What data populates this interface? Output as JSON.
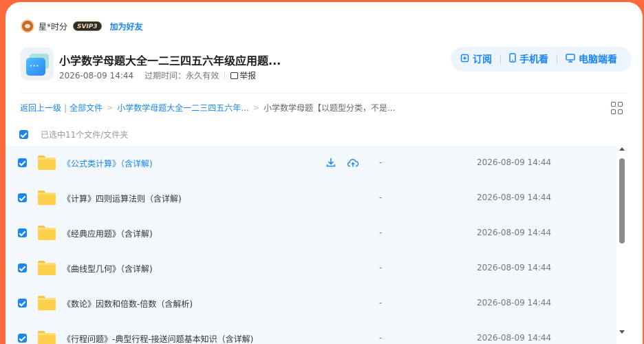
{
  "share": {
    "user_name": "星*时分",
    "vip_badge": "SVIP3",
    "add_friend": "加为好友"
  },
  "file": {
    "title": "小学数学母题大全一二三四五六年级应用题...",
    "date": "2026-08-09 14:44",
    "expire": "过期时间：永久有效",
    "report": "举报"
  },
  "actions": {
    "subscribe": "订阅",
    "mobile": "手机看",
    "desktop": "电脑端看"
  },
  "breadcrumb": {
    "back": "返回上一级",
    "all_files": "全部文件",
    "parent": "小学数学母题大全一二三四五六年...",
    "current": "小学数学母题【以题型分类，不是..."
  },
  "selection": {
    "text": "已选中11个文件/文件夹"
  },
  "rows": [
    {
      "name": "《公式类计算》（含详解)",
      "size": "-",
      "date": "2026-08-09 14:44"
    },
    {
      "name": "《计算》四则运算法则（含详解)",
      "size": "-",
      "date": "2026-08-09 14:44"
    },
    {
      "name": "《经典应用题》（含详解)",
      "size": "-",
      "date": "2026-08-09 14:44"
    },
    {
      "name": "《曲线型几何》（含详解)",
      "size": "-",
      "date": "2026-08-09 14:44"
    },
    {
      "name": "《数论》因数和倍数-倍数（含解析)",
      "size": "-",
      "date": "2026-08-09 14:44"
    },
    {
      "name": "《行程问题》-典型行程-接送问题基本知识（含详解)",
      "size": "-",
      "date": "2026-08-09 14:44"
    }
  ],
  "colors": {
    "accent": "#1a86f0",
    "page_background": "#ff6a3d",
    "folder": "#ffd04c"
  }
}
